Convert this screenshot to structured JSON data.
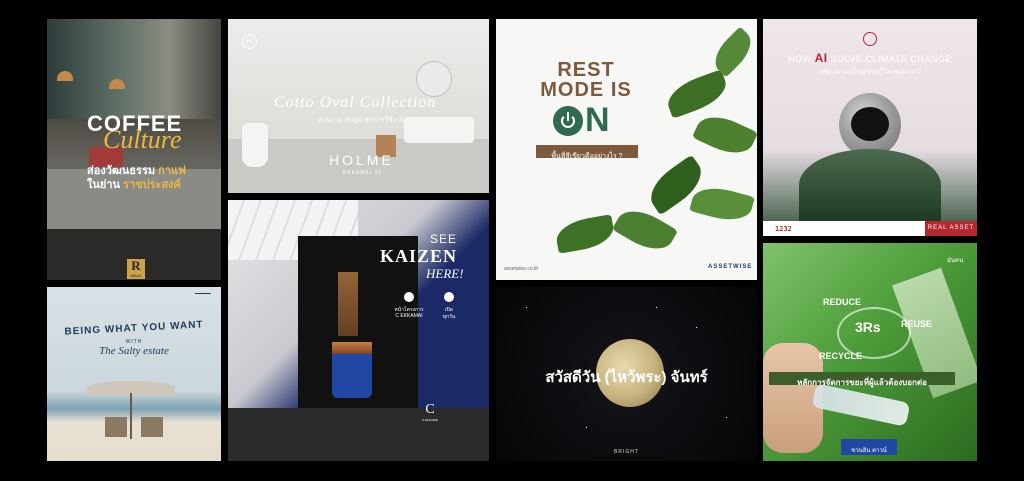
{
  "tiles": {
    "coffee": {
      "title1": "COFFEE",
      "title2": "Culture",
      "line1a": "ส่องวัฒนธรรม",
      "line1b": "กาแฟ",
      "line2a": "ในย่าน",
      "line2b": "ราชประสงค์",
      "badge": "R",
      "badge_sub": "WALK"
    },
    "holme": {
      "logo": "H",
      "script": "Cotto Oval Collection",
      "thai": "สวยงาม อบอุ่น ทุกการใช้งาน",
      "brand": "HOLME",
      "brand_sub": "EKKAMAI 22"
    },
    "rest": {
      "line1": "REST",
      "line2": "MODE IS",
      "on": "N",
      "banner": "พื้นที่สีเขียวคืออย่างไร ?",
      "url": "assetwise.co.th",
      "logo": "ASSETWISE"
    },
    "ai": {
      "title_a": "HOW",
      "title_ai": "AI",
      "title_b": "SOLVE CLIMATE CHANGE",
      "sub": "หรือ AI จะเป็นผู้ช่วยกู้โลกของเรา?",
      "footer_phone": "1232",
      "footer_brand": "REAL ASSET"
    },
    "being": {
      "title": "BEING WHAT YOU WANT",
      "with": "WITH",
      "script": "The Salty estate"
    },
    "kaizen": {
      "see": "SEE",
      "kaizen": "KAIZEN",
      "here": "HERE!",
      "loc_label": "หน้าโครงการ",
      "loc_value": "C EKKAMAI",
      "time_label": "เปิด",
      "time_value": "ทุกวัน",
      "logo": "C",
      "logo_sub": "C EKKAMAI"
    },
    "moon": {
      "text_a": "สวัสดีวัน",
      "text_b": "(ไหว้พระ)",
      "text_c": "จันทร์",
      "footer": "BRIGHT"
    },
    "recycle": {
      "brand": "มันคน",
      "reduce": "REDUCE",
      "reuse": "REUSE",
      "recycle": "RECYCLE",
      "center": "3Rs",
      "banner": "หลักการจัดการขยะที่ผู้แล้วต้องบอกต่อ",
      "footer": "ชวนอิน ตาวน์"
    }
  },
  "colors": {
    "rest_brown": "#7d5a3c",
    "rest_green": "#2f6b4f",
    "ai_red": "#b5282f",
    "kaizen_navy": "#1b2a66",
    "recycle_green": "#2a6b1f"
  }
}
